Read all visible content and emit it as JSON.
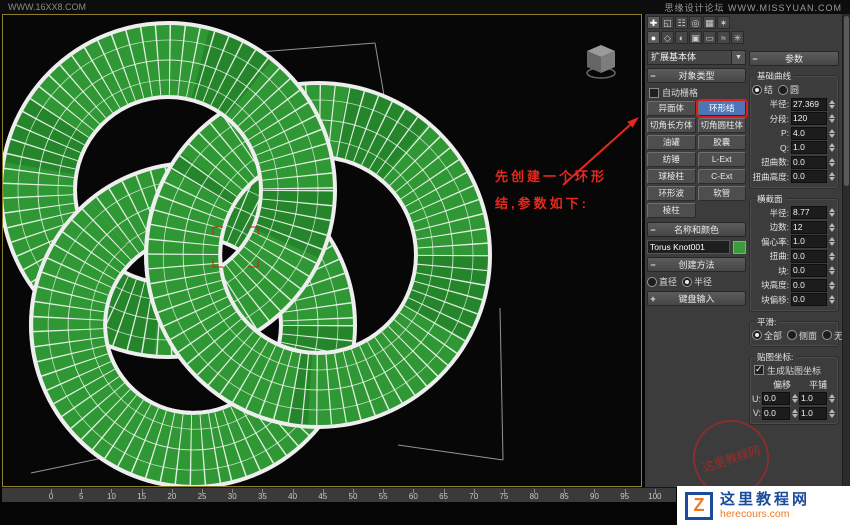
{
  "top_bar": {
    "watermark_left": "WWW.16XX8.COM",
    "site_right": "思缘设计论坛 WWW.MISSYUAN.COM"
  },
  "viewport": {
    "annotation": {
      "line1": "先创建一个环形",
      "line2": "结,参数如下:"
    }
  },
  "command_panel": {
    "tab_icons": [
      {
        "name": "create-tab-icon",
        "glyph": "✚",
        "active": true
      },
      {
        "name": "modify-tab-icon",
        "glyph": "◱"
      },
      {
        "name": "hierarchy-tab-icon",
        "glyph": "☷"
      },
      {
        "name": "motion-tab-icon",
        "glyph": "◎"
      },
      {
        "name": "display-tab-icon",
        "glyph": "▦"
      },
      {
        "name": "utilities-tab-icon",
        "glyph": "✶"
      }
    ],
    "category_icons": [
      {
        "name": "geometry-icon",
        "glyph": "●",
        "active": true
      },
      {
        "name": "shapes-icon",
        "glyph": "◇"
      },
      {
        "name": "lights-icon",
        "glyph": "◐"
      },
      {
        "name": "cameras-icon",
        "glyph": "▣"
      },
      {
        "name": "helpers-icon",
        "glyph": "▭"
      },
      {
        "name": "space-warps-icon",
        "glyph": "≈"
      },
      {
        "name": "systems-icon",
        "glyph": "✳"
      }
    ],
    "subcategory_dropdown": {
      "value": "扩展基本体"
    },
    "object_type": {
      "title": "对象类型",
      "autogrid_label": "自动栅格",
      "buttons": [
        "异面体",
        "环形结",
        "切角长方体",
        "切角圆柱体",
        "油罐",
        "胶囊",
        "纺锤",
        "L-Ext",
        "球棱柱",
        "C-Ext",
        "环形波",
        "软管",
        "棱柱"
      ],
      "active_button": "环形结"
    },
    "name_and_color": {
      "title": "名称和颜色",
      "object_name": "Torus Knot001",
      "color_swatch": "#3a9c3a"
    },
    "creation_method": {
      "title": "创建方法",
      "options": [
        "直径",
        "半径"
      ],
      "selected": "半径"
    },
    "keyboard_entry": {
      "title": "键盘输入"
    },
    "parameters": {
      "title": "参数",
      "base_curve": {
        "title": "基础曲线",
        "mode": {
          "options": [
            "结",
            "圆"
          ],
          "selected": "结"
        },
        "fields": [
          {
            "label": "半径:",
            "value": "27.369"
          },
          {
            "label": "分段:",
            "value": "120"
          },
          {
            "label": "P:",
            "value": "4.0"
          },
          {
            "label": "Q:",
            "value": "1.0"
          },
          {
            "label": "扭曲数:",
            "value": "0.0"
          },
          {
            "label": "扭曲高度:",
            "value": "0.0"
          }
        ]
      },
      "cross_section": {
        "title": "横截面",
        "fields": [
          {
            "label": "半径:",
            "value": "8.77"
          },
          {
            "label": "边数:",
            "value": "12"
          },
          {
            "label": "偏心率:",
            "value": "1.0"
          },
          {
            "label": "扭曲:",
            "value": "0.0"
          },
          {
            "label": "块:",
            "value": "0.0"
          },
          {
            "label": "块高度:",
            "value": "0.0"
          },
          {
            "label": "块偏移:",
            "value": "0.0"
          }
        ]
      },
      "smooth": {
        "title": "平滑:",
        "options": [
          "全部",
          "侧面",
          "无"
        ],
        "selected": "全部"
      },
      "mapping": {
        "title": "贴图坐标:",
        "generate_label": "生成贴图坐标",
        "generate_checked": true,
        "column_headers": [
          "偏移",
          "平铺"
        ],
        "rows": [
          {
            "label": "U:",
            "offset": "0.0",
            "tile": "1.0"
          },
          {
            "label": "V:",
            "offset": "0.0",
            "tile": "1.0"
          }
        ]
      }
    }
  },
  "timeline": {
    "ticks": [
      "0",
      "5",
      "10",
      "15",
      "20",
      "25",
      "30",
      "35",
      "40",
      "45",
      "50",
      "55",
      "60",
      "65",
      "70",
      "75",
      "80",
      "85",
      "90",
      "95",
      "100"
    ]
  },
  "watermarks": {
    "stamp_text": "这里教程网",
    "logo_title": "这里教程网",
    "logo_domain": "herecours.com"
  },
  "colors": {
    "knot_green": "#2f9733",
    "annotation_red": "#e8281e",
    "highlight_blue": "#4d76b8",
    "viewport_border": "#8f7e2c"
  }
}
